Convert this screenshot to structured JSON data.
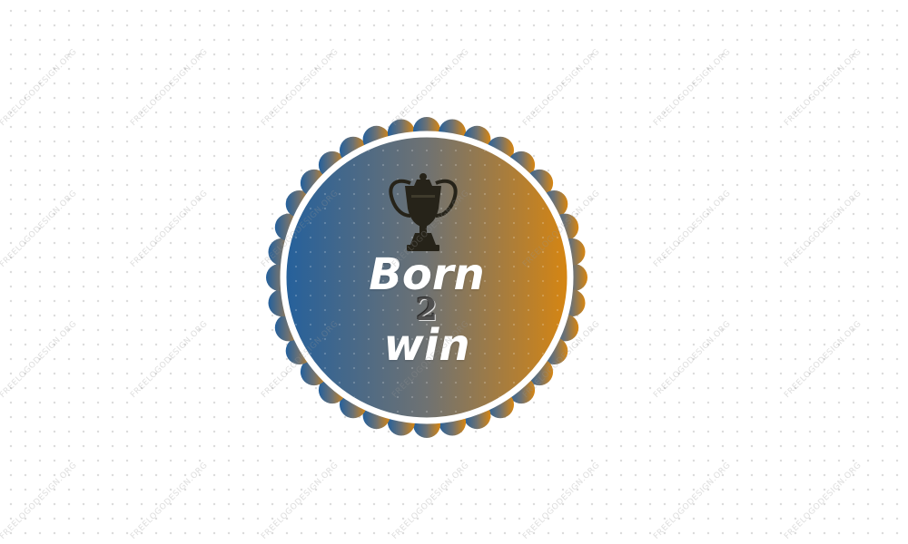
{
  "logo": {
    "line1": "Born",
    "line2": "2",
    "line3": "win",
    "emblem_icon": "trophy-icon"
  },
  "watermark": "FREELOGODESIGN.ORG",
  "colors": {
    "gradient_start": "#23609d",
    "gradient_mid": "#6f7272",
    "gradient_end": "#d9860f",
    "ring": "#ffffff",
    "trophy": "#262319",
    "text": "#ffffff",
    "numeral": "#505050"
  }
}
